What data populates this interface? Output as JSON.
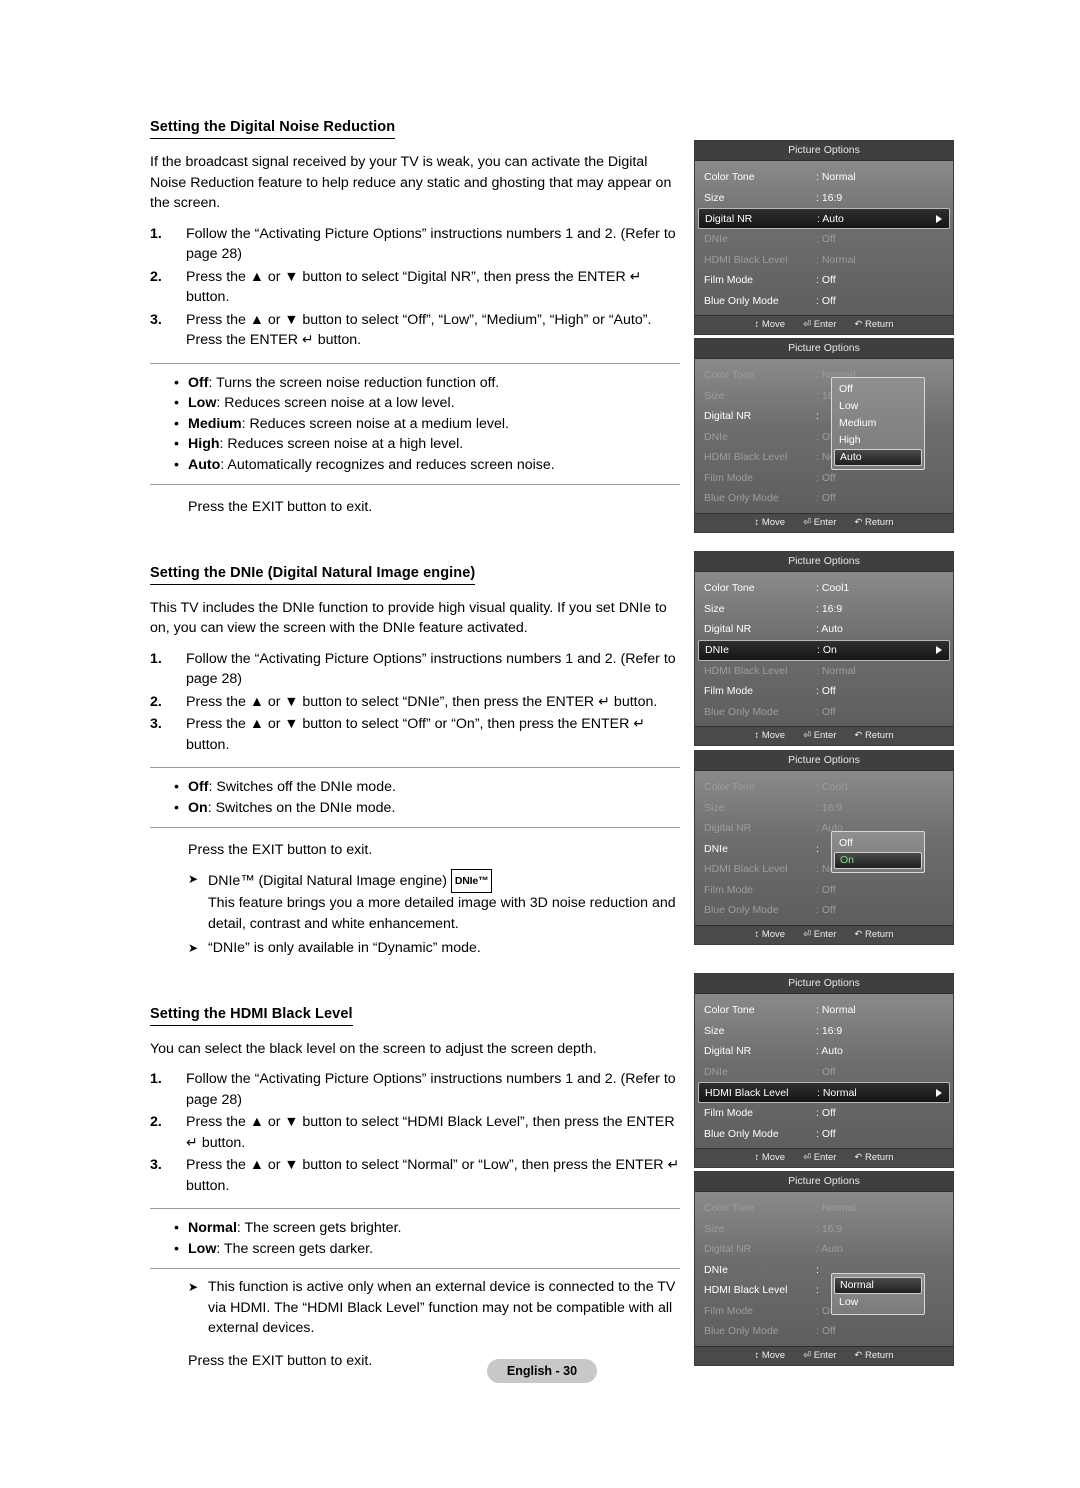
{
  "sections": [
    {
      "heading": "Setting the Digital Noise Reduction",
      "intro": "If the broadcast signal received by your TV is weak, you can activate the Digital Noise Reduction feature to help reduce any static and ghosting that may appear on the screen.",
      "steps": [
        {
          "num": "1.",
          "text": "Follow the “Activating Picture Options” instructions numbers 1 and 2. (Refer to page 28)"
        },
        {
          "num": "2.",
          "text": "Press the ▲ or ▼ button to select “Digital NR”, then press the ENTER ↵ button."
        },
        {
          "num": "3.",
          "text": "Press the ▲ or ▼ button to select “Off”, “Low”, “Medium”, “High” or “Auto”. Press the ENTER ↵ button."
        }
      ],
      "bullets": [
        {
          "term": "Off",
          "text": ": Turns the screen noise reduction function off."
        },
        {
          "term": "Low",
          "text": ": Reduces screen noise at a low level."
        },
        {
          "term": "Medium",
          "text": ": Reduces screen noise at a medium level."
        },
        {
          "term": "High",
          "text": ": Reduces screen noise at a high level."
        },
        {
          "term": "Auto",
          "text": ": Automatically recognizes and reduces screen noise."
        }
      ],
      "exit": "Press the EXIT button to exit."
    },
    {
      "heading": "Setting the DNIe (Digital Natural Image engine)",
      "intro": "This TV includes the DNIe function to provide high visual quality. If you set DNIe to on, you can view the screen with the DNIe feature activated.",
      "steps": [
        {
          "num": "1.",
          "text": "Follow the “Activating Picture Options” instructions numbers 1 and 2. (Refer to page 28)"
        },
        {
          "num": "2.",
          "text": "Press the ▲ or ▼ button to select “DNIe”, then press the ENTER ↵ button."
        },
        {
          "num": "3.",
          "text": "Press the ▲ or ▼ button to select “Off” or “On”, then press the ENTER ↵ button."
        }
      ],
      "bullets": [
        {
          "term": "Off",
          "text": ": Switches off the DNIe mode."
        },
        {
          "term": "On",
          "text": ": Switches on the DNIe mode."
        }
      ],
      "exit": "Press the EXIT button to exit.",
      "notes": [
        {
          "badge": "DNIe™",
          "text": "DNIe™ (Digital Natural Image engine) ",
          "text2": "This feature brings you a more detailed image with 3D noise reduction and detail, contrast and white enhancement."
        },
        {
          "text": "“DNIe” is only available in “Dynamic” mode."
        }
      ]
    },
    {
      "heading": "Setting the HDMI Black Level",
      "intro": "You can select the black level on the screen to adjust the screen depth.",
      "steps": [
        {
          "num": "1.",
          "text": "Follow the “Activating Picture Options” instructions numbers 1 and 2. (Refer to page 28)"
        },
        {
          "num": "2.",
          "text": "Press the ▲ or ▼ button to select “HDMI Black Level”, then press the ENTER ↵ button."
        },
        {
          "num": "3.",
          "text": "Press the ▲ or ▼ button to select “Normal” or “Low”, then press the ENTER ↵ button."
        }
      ],
      "bullets": [
        {
          "term": "Normal",
          "text": ": The screen gets brighter."
        },
        {
          "term": "Low",
          "text": ": The screen gets darker."
        }
      ],
      "notes": [
        {
          "text": "This function is active only when an external device is connected to the TV via HDMI. The “HDMI Black Level” function may not be compatible with all external devices."
        }
      ],
      "exit": "Press the EXIT button to exit."
    }
  ],
  "osd_common": {
    "title": "Picture Options",
    "footer": {
      "move": "Move",
      "enter": "Enter",
      "return": "Return"
    }
  },
  "osd_panels": [
    {
      "id": "panel1",
      "rows": [
        {
          "label": "Color Tone",
          "value": ": Normal",
          "state": "normal"
        },
        {
          "label": "Size",
          "value": ": 16:9",
          "state": "normal"
        },
        {
          "label": "Digital NR",
          "value": ": Auto",
          "state": "selected"
        },
        {
          "label": "DNIe",
          "value": ": Off",
          "state": "dim"
        },
        {
          "label": "HDMI Black Level",
          "value": ": Normal",
          "state": "dim"
        },
        {
          "label": "Film Mode",
          "value": ": Off",
          "state": "normal"
        },
        {
          "label": "Blue Only Mode",
          "value": ": Off",
          "state": "normal"
        }
      ]
    },
    {
      "id": "panel2",
      "rows": [
        {
          "label": "Color Tone",
          "value": ": Normal",
          "state": "dim"
        },
        {
          "label": "Size",
          "value": ": 16:9",
          "state": "dim"
        },
        {
          "label": "Digital NR",
          "value": ":",
          "state": "normal"
        },
        {
          "label": "DNIe",
          "value": ": Off",
          "state": "dim"
        },
        {
          "label": "HDMI Black Level",
          "value": ": Normal",
          "state": "dim"
        },
        {
          "label": "Film Mode",
          "value": ": Off",
          "state": "dim"
        },
        {
          "label": "Blue Only Mode",
          "value": ": Off",
          "state": "dim"
        }
      ],
      "dropdown": {
        "items": [
          "Off",
          "Low",
          "Medium",
          "High",
          "Auto"
        ],
        "highlight": "Auto"
      }
    },
    {
      "id": "panel3",
      "rows": [
        {
          "label": "Color Tone",
          "value": ": Cool1",
          "state": "normal"
        },
        {
          "label": "Size",
          "value": ": 16:9",
          "state": "normal"
        },
        {
          "label": "Digital NR",
          "value": ": Auto",
          "state": "normal"
        },
        {
          "label": "DNIe",
          "value": ": On",
          "state": "selected"
        },
        {
          "label": "HDMI Black Level",
          "value": ": Normal",
          "state": "dim"
        },
        {
          "label": "Film Mode",
          "value": ": Off",
          "state": "normal"
        },
        {
          "label": "Blue Only Mode",
          "value": ": Off",
          "state": "dim"
        }
      ]
    },
    {
      "id": "panel4",
      "rows": [
        {
          "label": "Color Tone",
          "value": ": Cool1",
          "state": "dim"
        },
        {
          "label": "Size",
          "value": ": 16:9",
          "state": "dim"
        },
        {
          "label": "Digital NR",
          "value": ": Auto",
          "state": "dim"
        },
        {
          "label": "DNIe",
          "value": ":",
          "state": "normal"
        },
        {
          "label": "HDMI Black Level",
          "value": ": Normal",
          "state": "dim"
        },
        {
          "label": "Film Mode",
          "value": ": Off",
          "state": "dim"
        },
        {
          "label": "Blue Only Mode",
          "value": ": Off",
          "state": "dim"
        }
      ],
      "dropdown": {
        "items": [
          "Off",
          "On"
        ],
        "highlight": "On"
      }
    },
    {
      "id": "panel5",
      "rows": [
        {
          "label": "Color Tone",
          "value": ": Normal",
          "state": "normal"
        },
        {
          "label": "Size",
          "value": ": 16:9",
          "state": "normal"
        },
        {
          "label": "Digital NR",
          "value": ": Auto",
          "state": "normal"
        },
        {
          "label": "DNIe",
          "value": ": Off",
          "state": "dim"
        },
        {
          "label": "HDMI Black Level",
          "value": ": Normal",
          "state": "selected"
        },
        {
          "label": "Film Mode",
          "value": ": Off",
          "state": "normal"
        },
        {
          "label": "Blue Only Mode",
          "value": ": Off",
          "state": "normal"
        }
      ]
    },
    {
      "id": "panel6",
      "rows": [
        {
          "label": "Color Tone",
          "value": ": Normal",
          "state": "dim"
        },
        {
          "label": "Size",
          "value": ": 16:9",
          "state": "dim"
        },
        {
          "label": "Digital NR",
          "value": ": Auto",
          "state": "dim"
        },
        {
          "label": "DNIe",
          "value": ":",
          "state": "dim"
        },
        {
          "label": "HDMI Black Level",
          "value": ":",
          "state": "normal"
        },
        {
          "label": "Film Mode",
          "value": ": Off",
          "state": "dim"
        },
        {
          "label": "Blue Only Mode",
          "value": ": Off",
          "state": "dim"
        }
      ],
      "dropdown": {
        "items": [
          "Normal",
          "Low"
        ],
        "highlight": "Normal"
      }
    }
  ],
  "footer": {
    "page_label": "English - 30"
  }
}
